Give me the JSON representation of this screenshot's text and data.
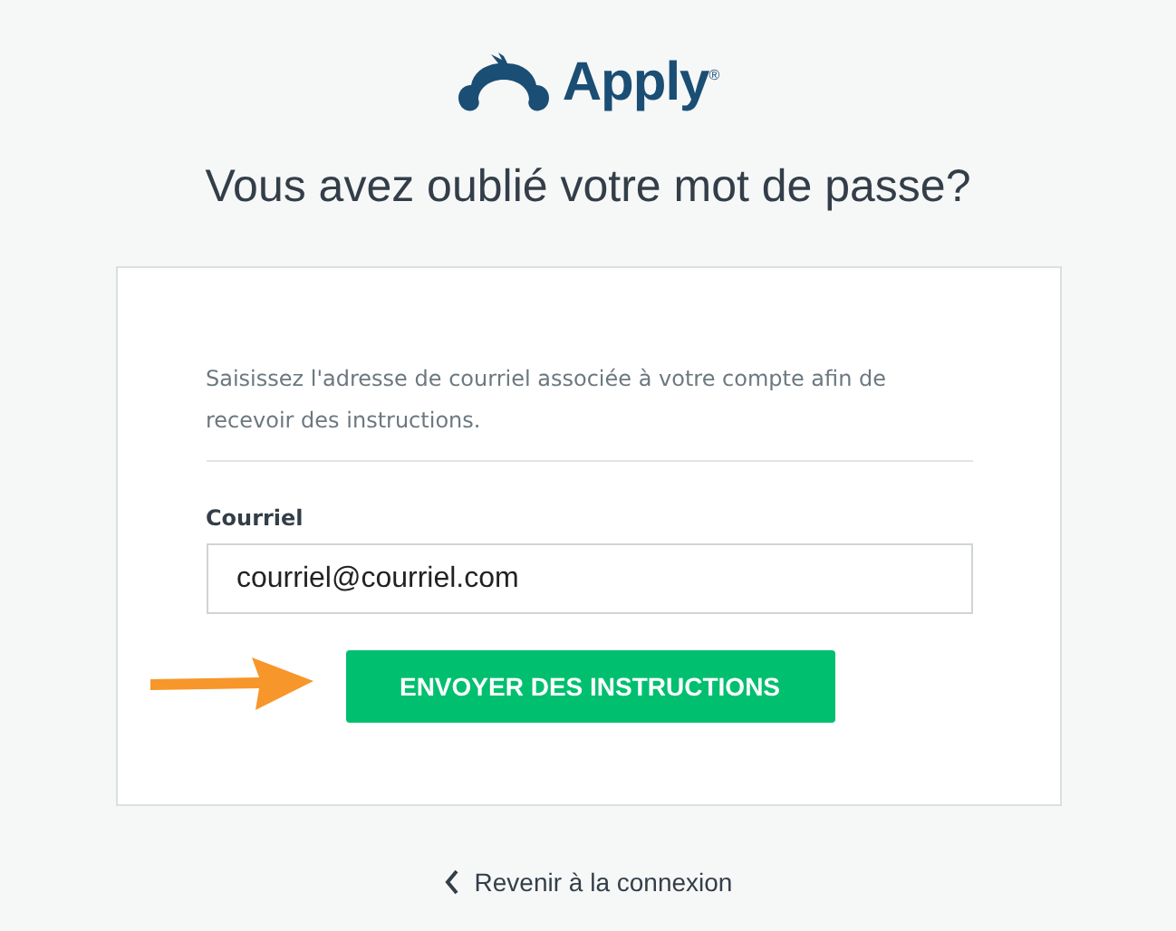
{
  "logo": {
    "text": "Apply$^{®}$"
  },
  "title": "Vous avez oublié votre mot de passe?",
  "form": {
    "description": "Saisissez l'adresse de courriel associée à votre compte afin de recevoir des instructions.",
    "email": {
      "label": "Courriel",
      "value": "courriel@courriel.com"
    },
    "submit": "ENVOYER DES INSTRUCTIONS"
  },
  "back_link": "Revenir à la connexion"
}
